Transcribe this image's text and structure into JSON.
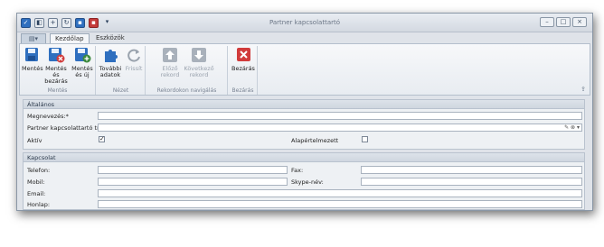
{
  "window": {
    "title": "Partner kapcsolattartó"
  },
  "tabs": [
    {
      "label": "Kezdőlap",
      "active": true
    },
    {
      "label": "Eszközök",
      "active": false
    }
  ],
  "ribbon": {
    "groups": [
      {
        "label": "Mentés",
        "buttons": [
          {
            "label1": "Mentés",
            "label2": "",
            "icon": "floppy-icon"
          },
          {
            "label1": "Mentés és",
            "label2": "bezárás",
            "icon": "floppy-close-icon"
          },
          {
            "label1": "Mentés",
            "label2": "és új",
            "icon": "floppy-new-icon"
          }
        ]
      },
      {
        "label": "Nézet",
        "buttons": [
          {
            "label1": "További",
            "label2": "adatok",
            "icon": "puzzle-icon"
          },
          {
            "label1": "Frissít",
            "label2": "",
            "icon": "refresh-icon",
            "disabled": true
          }
        ]
      },
      {
        "label": "Rekordokon navigálás",
        "buttons": [
          {
            "label1": "Előző",
            "label2": "rekord",
            "icon": "arrow-up-icon",
            "disabled": true
          },
          {
            "label1": "Következő",
            "label2": "rekord",
            "icon": "arrow-down-icon",
            "disabled": true
          }
        ]
      },
      {
        "label": "Bezárás",
        "buttons": [
          {
            "label1": "Bezárás",
            "label2": "",
            "icon": "close-red-icon"
          }
        ]
      }
    ]
  },
  "sections": {
    "general": {
      "title": "Általános",
      "name_label": "Megnevezés:*",
      "name_value": "",
      "type_label": "Partner kapcsolattartó típus:",
      "type_value": "",
      "active_label": "Aktív",
      "active_checked": true,
      "default_label": "Alapértelmezett",
      "default_checked": false
    },
    "contact": {
      "title": "Kapcsolat",
      "phone_label": "Telefon:",
      "fax_label": "Fax:",
      "mobile_label": "Mobil:",
      "skype_label": "Skype-név:",
      "email_label": "Email:",
      "web_label": "Honlap:"
    }
  },
  "colors": {
    "accent": "#2f6fbf",
    "danger": "#c43b3b",
    "disabled": "#9aa3ae"
  }
}
